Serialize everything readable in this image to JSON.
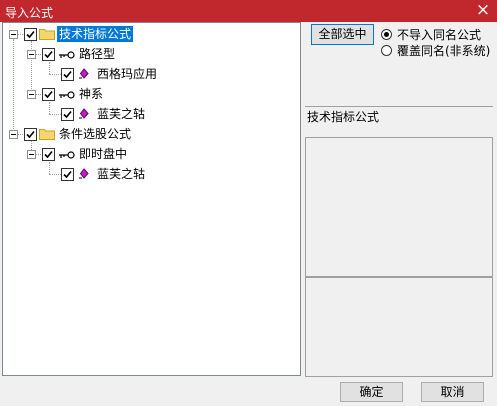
{
  "window": {
    "title": "导入公式",
    "close_glyph": "×"
  },
  "tree": [
    {
      "label": "技术指标公式",
      "children": [
        {
          "label": "路径型",
          "children": [
            {
              "label": "西格玛应用"
            }
          ]
        },
        {
          "label": "神系",
          "children": [
            {
              "label": "蓝芙之轱"
            }
          ]
        }
      ]
    },
    {
      "label": "条件选股公式",
      "children": [
        {
          "label": "即时盘中",
          "children": [
            {
              "label": "蓝芙之轱"
            }
          ]
        }
      ]
    }
  ],
  "icons": {
    "root": "folder-icon",
    "group": "key-icon",
    "formula": "diamond-icon"
  },
  "right": {
    "select_all_label": "全部选中",
    "radio_options": [
      {
        "label": "不导入同名公式",
        "selected": true
      },
      {
        "label": "覆盖同名(非系统)",
        "selected": false
      }
    ],
    "category_label": "技术指标公式"
  },
  "footer": {
    "ok_label": "确定",
    "cancel_label": "取消"
  },
  "colors": {
    "titlebar": "#c0282d",
    "selection": "#0078d7"
  }
}
